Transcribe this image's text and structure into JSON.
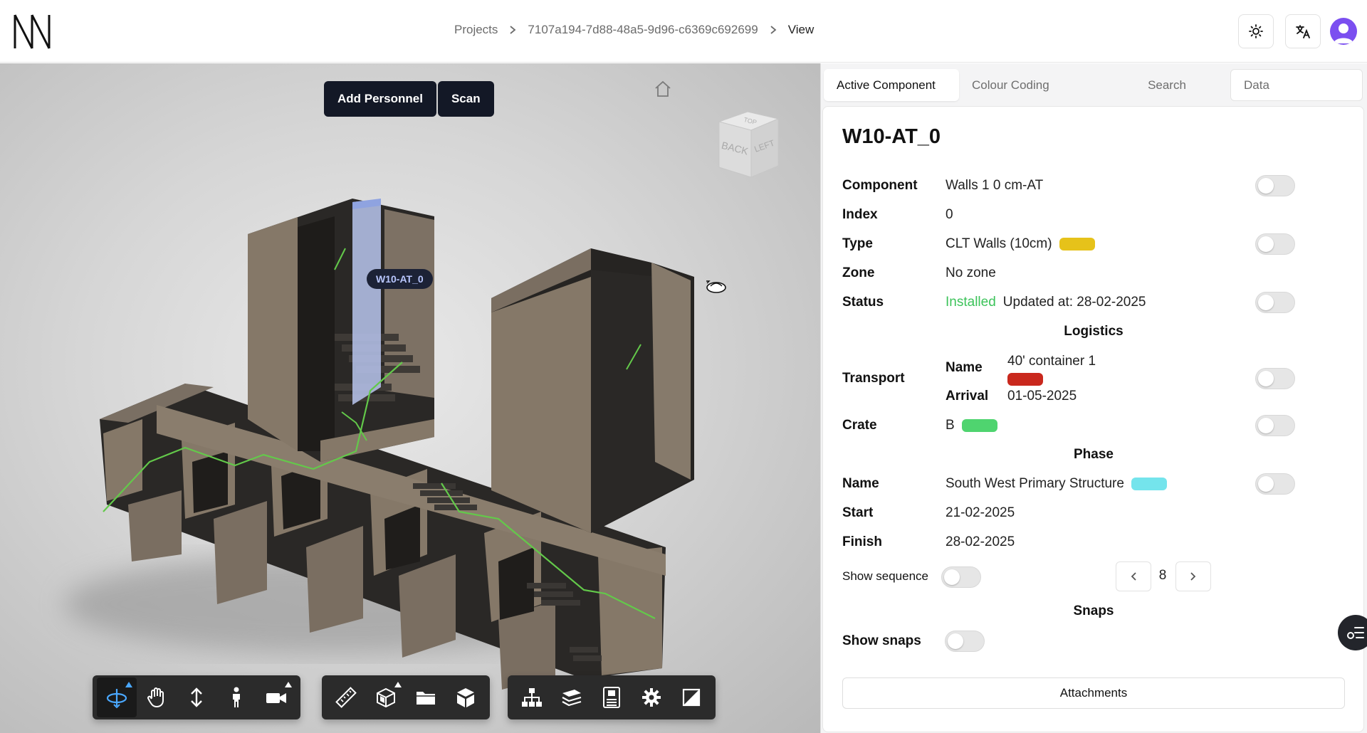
{
  "header": {
    "breadcrumb": {
      "projects": "Projects",
      "project_id": "7107a194-7d88-48a5-9d96-c6369c692699",
      "current": "View"
    }
  },
  "viewer": {
    "add_personnel_label": "Add Personnel",
    "scan_label": "Scan",
    "component_tag": "W10-AT_0",
    "view_cube_faces": {
      "top": "TOP",
      "back": "BACK",
      "left": "LEFT"
    },
    "toolbar_groups": [
      [
        "orbit-tool",
        "pan-tool",
        "zoom-tool",
        "first-person-tool",
        "camera-tool"
      ],
      [
        "measure-tool",
        "section-tool",
        "explode-tool",
        "model-tool"
      ],
      [
        "model-browser-tool",
        "layers-tool",
        "properties-tool",
        "settings-tool",
        "fullscreen-tool"
      ]
    ]
  },
  "tabs": [
    "Active Component",
    "Colour Coding",
    "Search",
    "Data"
  ],
  "component": {
    "title": "W10-AT_0",
    "component_label": "Component",
    "component_value": "Walls 1 0 cm-AT",
    "index_label": "Index",
    "index_value": "0",
    "type_label": "Type",
    "type_value": "CLT Walls (10cm)",
    "type_color": "#e6c21a",
    "zone_label": "Zone",
    "zone_value": "No zone",
    "status_label": "Status",
    "status_value": "Installed",
    "status_color": "#3cc35a",
    "status_updated": "Updated at: 28-02-2025"
  },
  "logistics": {
    "heading": "Logistics",
    "transport_label": "Transport",
    "name_label": "Name",
    "name_value": "40' container 1",
    "name_color": "#c9281d",
    "arrival_label": "Arrival",
    "arrival_value": "01-05-2025",
    "crate_label": "Crate",
    "crate_value": "B",
    "crate_color": "#4fd46f"
  },
  "phase": {
    "heading": "Phase",
    "name_label": "Name",
    "name_value": "South West Primary Structure",
    "name_color": "#74e4ec",
    "start_label": "Start",
    "start_value": "21-02-2025",
    "finish_label": "Finish",
    "finish_value": "28-02-2025",
    "show_sequence_label": "Show sequence",
    "sequence_number": "8"
  },
  "snaps": {
    "heading": "Snaps",
    "show_snaps_label": "Show snaps"
  },
  "attachments_label": "Attachments"
}
